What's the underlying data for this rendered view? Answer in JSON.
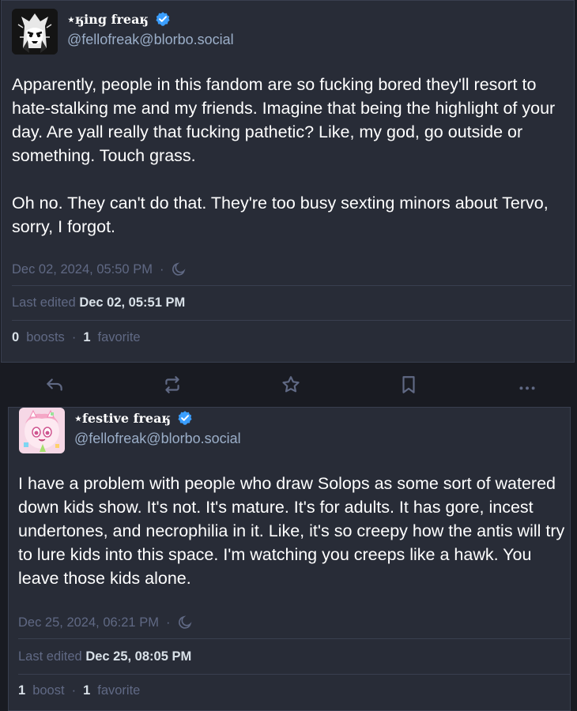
{
  "post1": {
    "display_name": "⋆ӄing freaӄ",
    "handle": "@fellofreak@blorbo.social",
    "paragraphs": [
      "Apparently, people in this fandom are so fucking bored they'll resort to hate-stalking me and my friends. Imagine that being the highlight of your day. Are yall really that fucking pathetic? Like, my god, go outside or something. Touch grass.",
      "Oh no. They can't do that. They're too busy sexting minors about Tervo, sorry, I forgot."
    ],
    "timestamp": "Dec 02, 2024, 05:50 PM",
    "edited_label": "Last edited",
    "edited_value": "Dec 02, 05:51 PM",
    "boosts_count": "0",
    "boosts_label": "boosts",
    "favorites_count": "1",
    "favorites_label": "favorite"
  },
  "post2": {
    "display_name": "⋆festive freaӄ",
    "handle": "@fellofreak@blorbo.social",
    "paragraphs": [
      "I have a problem with people who draw Solops as some sort of watered down kids show. It's not. It's mature. It's for adults. It has gore, incest undertones, and necrophilia in it. Like, it's so creepy how the antis will try to lure kids into this space. I'm watching you creeps like a hawk. You leave those kids alone."
    ],
    "timestamp": "Dec 25, 2024, 06:21 PM",
    "edited_label": "Last edited",
    "edited_value": "Dec 25, 08:05 PM",
    "boosts_count": "1",
    "boosts_label": "boost",
    "favorites_count": "1",
    "favorites_label": "favorite"
  },
  "separator": "·",
  "icons": {
    "verified": "verified-check-icon",
    "visibility": "moon-icon",
    "reply": "reply-icon",
    "boost": "boost-icon",
    "favorite": "star-icon",
    "bookmark": "bookmark-icon",
    "more": "more-icon"
  },
  "colors": {
    "background": "#191b22",
    "card": "#282c37",
    "muted": "#606984",
    "handle": "#9baec8",
    "verified": "#3a9eff"
  }
}
